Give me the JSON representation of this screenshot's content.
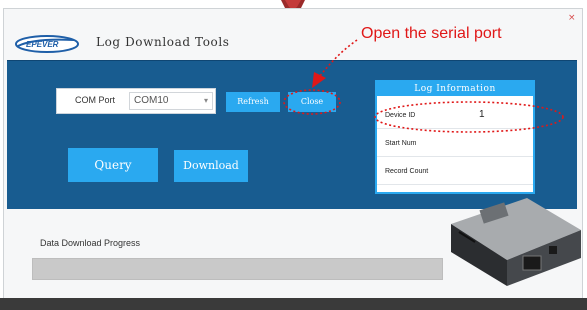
{
  "window": {
    "close_glyph": "×"
  },
  "app": {
    "logo_text": "EPEVER",
    "title": "Log Download Tools"
  },
  "annotation": {
    "text": "Open the serial port",
    "color": "#e01818"
  },
  "connection": {
    "com_port_label": "COM Port",
    "com_port_value": "COM10",
    "refresh_label": "Refresh",
    "close_label": "Close"
  },
  "actions": {
    "query_label": "Query",
    "download_label": "Download"
  },
  "log_info": {
    "title": "Log Information",
    "rows": [
      {
        "label": "Device ID",
        "value": "1"
      },
      {
        "label": "Start Num",
        "value": ""
      },
      {
        "label": "Record Count",
        "value": ""
      }
    ]
  },
  "progress": {
    "label": "Data Download Progress",
    "fraction": 0
  },
  "colors": {
    "panel": "#185c90",
    "button": "#2aa9f0",
    "annotation": "#e01818",
    "progress_track": "#c9c9c9"
  },
  "icons": {
    "device_image": "logger-device-icon",
    "chevron": "chevron-down-icon",
    "top_icon": "red-shield-icon"
  }
}
